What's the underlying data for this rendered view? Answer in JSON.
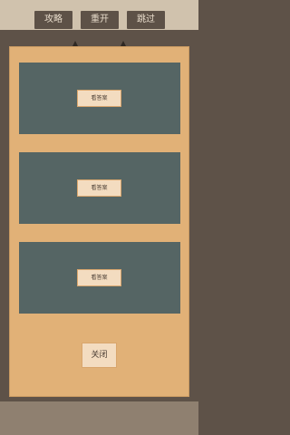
{
  "toolbar": {
    "guide_label": "攻略",
    "restart_label": "重开",
    "skip_label": "跳过"
  },
  "panel": {
    "cards": [
      {
        "button_label": "看答案"
      },
      {
        "button_label": "看答案"
      },
      {
        "button_label": "看答案"
      }
    ],
    "close_label": "关闭"
  },
  "icons": {
    "left_marker": "triangle-up-icon",
    "right_marker": "triangle-up-icon"
  },
  "colors": {
    "panel_bg": "#e1b177",
    "card_bg": "#556564",
    "button_bg": "#f3dcc0",
    "toolbar_button_bg": "#5d5147",
    "background": "#5e5248"
  }
}
